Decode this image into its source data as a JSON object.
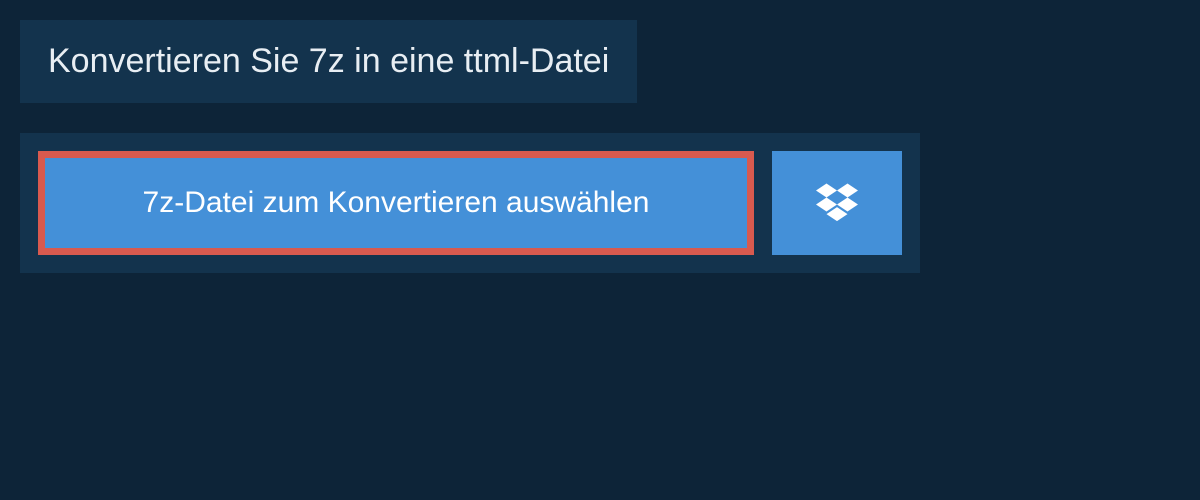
{
  "header": {
    "title": "Konvertieren Sie 7z in eine ttml-Datei"
  },
  "upload": {
    "select_button_label": "7z-Datei zum Konvertieren auswählen"
  },
  "colors": {
    "background": "#0d2438",
    "panel": "#13334d",
    "button": "#4490d8",
    "highlight_border": "#d85a4f",
    "text_light": "#e8eef3",
    "text_white": "#ffffff"
  }
}
